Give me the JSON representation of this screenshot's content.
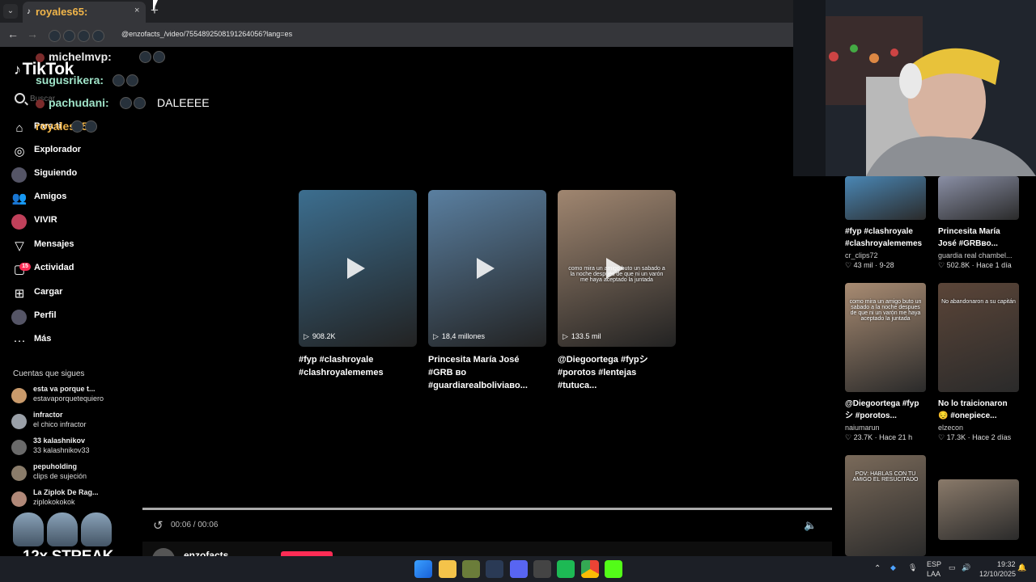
{
  "browser": {
    "tab_title": "royales65:",
    "tab_close": "×",
    "new_tab": "+",
    "url_text": "@enzofacts_/video/7554892508191264056?lang=es"
  },
  "sidebar": {
    "logo": "TikTok",
    "search_placeholder": "Buscar",
    "items": [
      {
        "label": "Para ti",
        "icon": "home-icon"
      },
      {
        "label": "Explorador",
        "icon": "compass-icon"
      },
      {
        "label": "Siguiendo",
        "icon": "following-avatar-icon"
      },
      {
        "label": "Amigos",
        "icon": "friends-icon"
      },
      {
        "label": "VIVIR",
        "icon": "live-avatar-icon"
      },
      {
        "label": "Mensajes",
        "icon": "send-icon"
      },
      {
        "label": "Actividad",
        "icon": "inbox-icon"
      },
      {
        "label": "Cargar",
        "icon": "upload-plus-icon"
      },
      {
        "label": "Perfil",
        "icon": "profile-avatar-icon"
      },
      {
        "label": "Más",
        "icon": "more-dots-icon"
      }
    ],
    "activity_badge": "15",
    "following_heading": "Cuentas que sigues",
    "following": [
      {
        "name": "esta va porque t...",
        "handle": "estavaporquetequiero",
        "color": "#c99a6b"
      },
      {
        "name": "infractor",
        "handle": "el chico infractor",
        "color": "#9aa0a8"
      },
      {
        "name": "33 kalashnikov",
        "handle": "33 kalashnikov33",
        "color": "#6a6a6a"
      },
      {
        "name": "pepuholding",
        "handle": "clips de sujeción",
        "color": "#8a7c6a"
      },
      {
        "name": "La Ziplok De Rag...",
        "handle": "ziplokokokok",
        "color": "#b08878"
      }
    ]
  },
  "chat": [
    {
      "user": "michelmvp:",
      "color": "#e9e9e9",
      "message": ""
    },
    {
      "user": "sugusrikera:",
      "color": "#9fe3c8",
      "message": ""
    },
    {
      "user": "pachudani:",
      "color": "#9fe3c8",
      "message": "DALEEEE"
    },
    {
      "user": "royales65:",
      "color": "#f2b64a",
      "message": ""
    }
  ],
  "videos": [
    {
      "views": "908.2K",
      "title": "#fyp #clashroyale #clashroyalememes",
      "thumb": "#3c6e8f"
    },
    {
      "views": "18,4 millones",
      "title": "Princesita María José #GRB ʙᴏ #guardiarealboliviaʙo...",
      "thumb": "#5a7fa0"
    },
    {
      "views": "133.5 mil",
      "title": "@Diegoortega #fypシ #porotos #lentejas #tutuca...",
      "thumb": "#a08670",
      "overlay": "como mira un amigo buto un sabado a la noche después de que ni un varón me haya aceptado la juntada"
    }
  ],
  "player": {
    "time": "00:06 / 00:06",
    "author": "enzofacts_",
    "progress": 1.0
  },
  "recommended": [
    {
      "title": "#fyp #clashroyale #clashroyalememes",
      "user": "cr_clips72",
      "meta": "♡ 43 mil · 9-28",
      "thumb": "#4a87b5"
    },
    {
      "title": "Princesita María José #GRBʙo...",
      "user": "guardia real chambel...",
      "meta": "♡ 502.8K · Hace 1 día",
      "thumb": "#8a8fa5"
    },
    {
      "title": "@Diegoortega #fyp シ #porotos...",
      "user": "naiumarun",
      "meta": "♡ 23.7K · Hace 21 h",
      "thumb": "#a88b72",
      "overlay": "como mira un amigo buto un sabado a la noche despues de que ni un varón me haya aceptado la juntada"
    },
    {
      "title": "No lo traicionaron 😔 #onepiece...",
      "user": "elzecon",
      "meta": "♡ 17.3K · Hace 2 días",
      "thumb": "#5b4538",
      "overlay": "No abandonaron a su capitán"
    },
    {
      "title": "",
      "user": "",
      "meta": "",
      "thumb": "#7a6a5a",
      "overlay": "POV: HABLAS CON TU AMIGO EL RESUCITADO"
    },
    {
      "title": "",
      "user": "",
      "meta": "",
      "thumb": "#8a7a6a"
    }
  ],
  "streak": {
    "label": "12x STREAK"
  },
  "taskbar": {
    "lang": "ESP",
    "lang2": "LAA",
    "time": "19:32",
    "date": "12/10/2025"
  }
}
